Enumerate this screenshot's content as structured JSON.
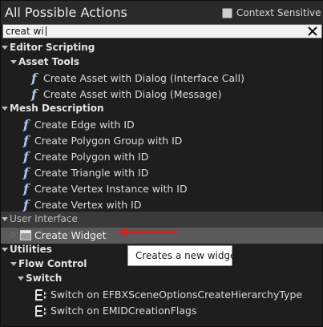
{
  "header": {
    "title": "All Possible Actions",
    "context_sensitive_label": "Context Sensitive"
  },
  "search": {
    "value": "creat wi"
  },
  "categories": {
    "editor_scripting": "Editor Scripting",
    "asset_tools": "Asset Tools",
    "mesh_description": "Mesh Description",
    "user_interface": "User Interface",
    "utilities": "Utilities",
    "flow_control": "Flow Control",
    "switch": "Switch"
  },
  "items": {
    "asset_tools": [
      "Create Asset with Dialog (Interface Call)",
      "Create Asset with Dialog (Message)"
    ],
    "mesh_description": [
      "Create Edge with ID",
      "Create Polygon Group with ID",
      "Create Polygon with ID",
      "Create Triangle with ID",
      "Create Vertex Instance with ID",
      "Create Vertex with ID"
    ],
    "user_interface": [
      "Create Widget"
    ],
    "switch": [
      "Switch on EFBXSceneOptionsCreateHierarchyType",
      "Switch on EMIDCreationFlags"
    ]
  },
  "tooltip": {
    "text": "Creates a new widget"
  },
  "icons": {
    "function": "f",
    "star": "☆"
  },
  "colors": {
    "accent_annotation": "#d62020",
    "function_icon": "#a9c6ef",
    "selection": "#5a5a5a"
  }
}
